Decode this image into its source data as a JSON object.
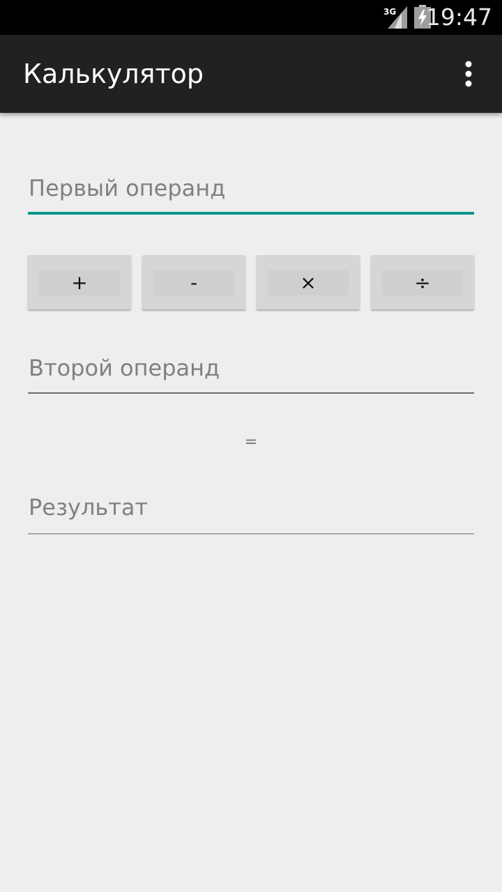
{
  "status_bar": {
    "network_type": "3G",
    "time": "19:47",
    "icons": [
      "signal-icon",
      "battery-icon"
    ]
  },
  "app_bar": {
    "title": "Калькулятор",
    "overflow_icon": "more-vert-icon"
  },
  "form": {
    "first_operand": {
      "value": "",
      "placeholder": "Первый операнд"
    },
    "operators": [
      {
        "label": "+"
      },
      {
        "label": "-"
      },
      {
        "label": "×"
      },
      {
        "label": "÷"
      }
    ],
    "second_operand": {
      "value": "",
      "placeholder": "Второй операнд"
    },
    "equals_label": "=",
    "result": {
      "value": "",
      "placeholder": "Результат"
    }
  },
  "colors": {
    "accent": "#009688",
    "app_bar": "#212121",
    "status_bar": "#000000",
    "background": "#eeeeee",
    "button": "#d6d6d6"
  }
}
